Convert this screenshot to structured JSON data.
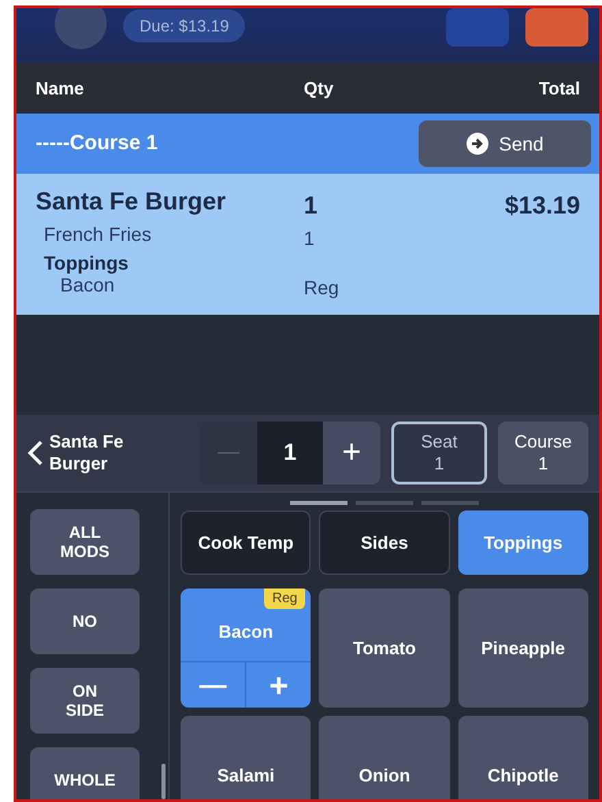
{
  "header": {
    "due": "Due: $13.19"
  },
  "columns": [
    "Name",
    "Qty",
    "Total"
  ],
  "course": {
    "label": "-----Course 1",
    "button": "Send"
  },
  "order_items": [
    {
      "kind": "item",
      "name": "Santa Fe Burger",
      "qty": "1",
      "total": "$13.19"
    },
    {
      "kind": "side",
      "name": "French Fries",
      "qty": "1"
    },
    {
      "kind": "group",
      "name": "Toppings"
    },
    {
      "kind": "modifier",
      "name": "Bacon",
      "qty": "Reg"
    }
  ],
  "item_bar": {
    "name": "Santa Fe Burger",
    "minus": "—",
    "quantity": "1",
    "plus": "+",
    "seat": [
      "Seat",
      "1"
    ],
    "course": [
      "Course",
      "1"
    ]
  },
  "pager": [
    {
      "selected": true
    },
    {
      "selected": false
    },
    {
      "selected": false
    }
  ],
  "mod_types": [
    {
      "label": "ALL MODS",
      "selected": false
    },
    {
      "label": "NO",
      "selected": false
    },
    {
      "label": "ON SIDE",
      "selected": false
    },
    {
      "label": "WHOLE",
      "selected": false
    }
  ],
  "categories": [
    {
      "label": "Cook Temp",
      "selected": false
    },
    {
      "label": "Sides",
      "selected": false
    },
    {
      "label": "Toppings",
      "selected": true
    }
  ],
  "modifiers": [
    {
      "label": "Bacon",
      "selected": true,
      "badge": "Reg",
      "minus": "—",
      "plus": "+"
    },
    {
      "label": "Tomato",
      "selected": false
    },
    {
      "label": "Pineapple",
      "selected": false
    },
    {
      "label": "Salami",
      "selected": false
    },
    {
      "label": "Onion",
      "selected": false
    },
    {
      "label": "Chipotle",
      "selected": false
    }
  ]
}
